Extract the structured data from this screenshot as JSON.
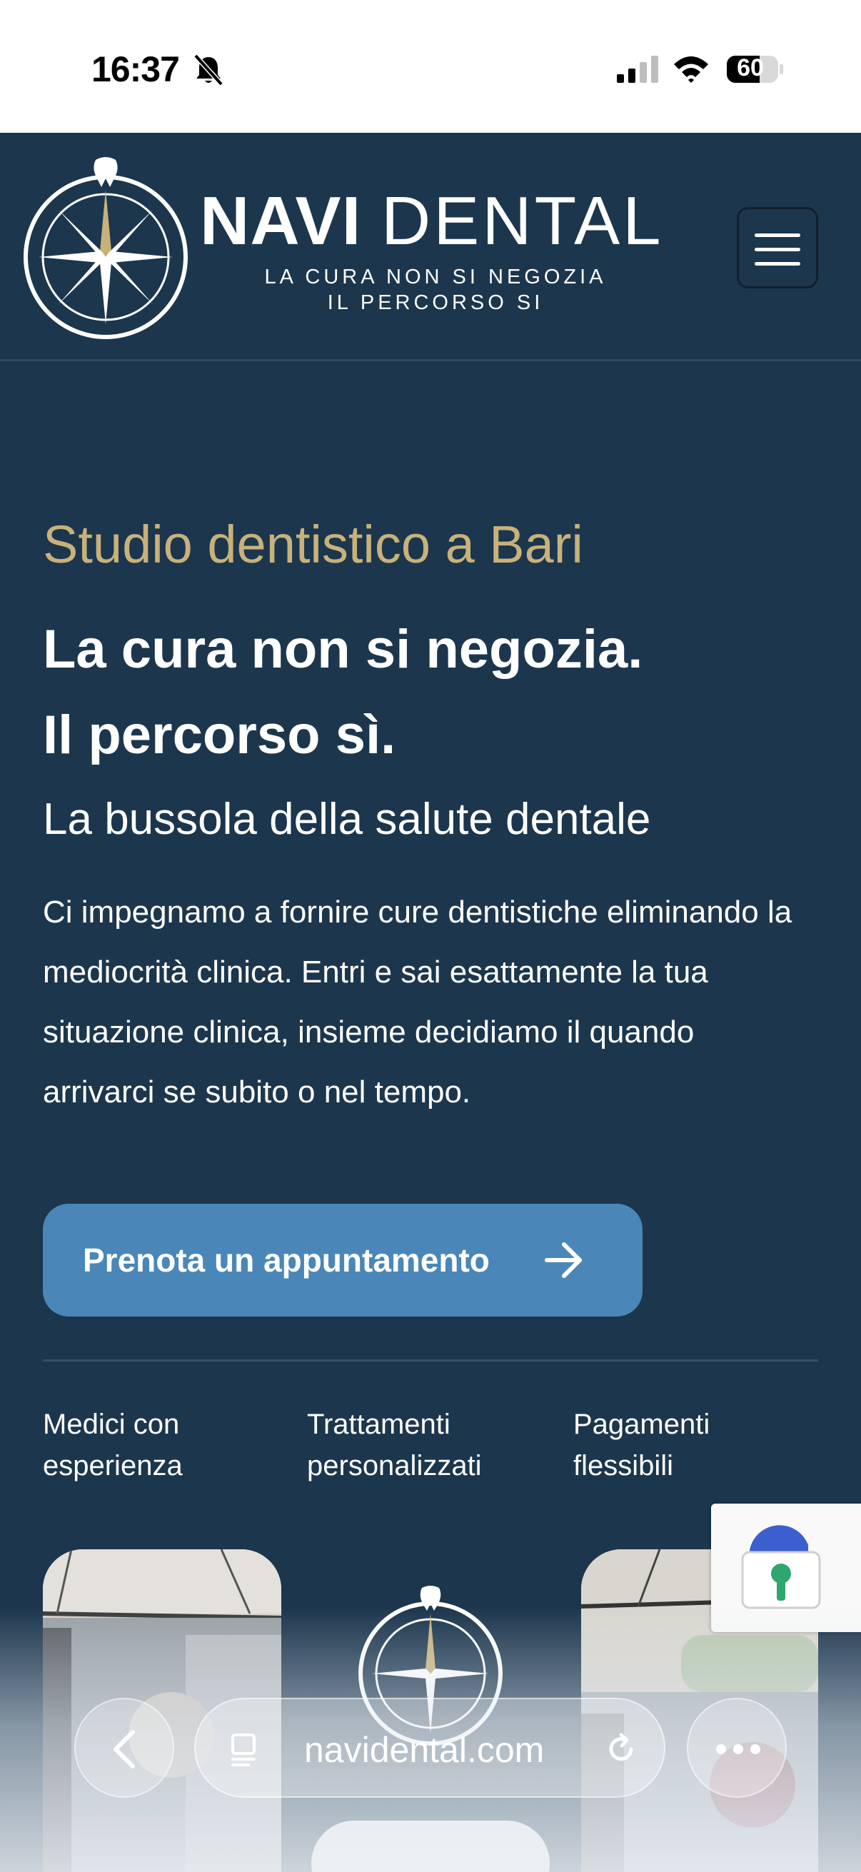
{
  "status_bar": {
    "time": "16:37",
    "battery": "60",
    "icons": [
      "bell-slash-icon",
      "signal-icon",
      "wifi-icon",
      "battery-icon"
    ]
  },
  "header": {
    "brand_bold": "NAVI",
    "brand_light": "DENTAL",
    "tagline_line1": "LA CURA NON SI NEGOZIA",
    "tagline_line2": "IL PERCORSO SI",
    "menu_icon": "hamburger-menu-icon"
  },
  "hero": {
    "eyebrow": "Studio dentistico a Bari",
    "headline_line1": "La cura non si negozia.",
    "headline_line2": "Il percorso sì.",
    "subhead": "La bussola della salute dentale",
    "body": "Ci impegnamo a fornire cure dentistiche eliminando la mediocrità clinica. Entri e sai esattamente la tua situazione clinica, insieme decidiamo il quando arrivarci se subito o nel tempo.",
    "cta_label": "Prenota un appuntamento"
  },
  "features": [
    {
      "line1": "Medici con",
      "line2": "esperienza"
    },
    {
      "line1": "Trattamenti",
      "line2": "personalizzati"
    },
    {
      "line1": "Pagamenti",
      "line2": "flessibili"
    }
  ],
  "browser": {
    "url": "navidental.com"
  },
  "colors": {
    "background": "#1c364d",
    "accent_gold": "#c8b27a",
    "cta_blue": "#4a87b8"
  }
}
